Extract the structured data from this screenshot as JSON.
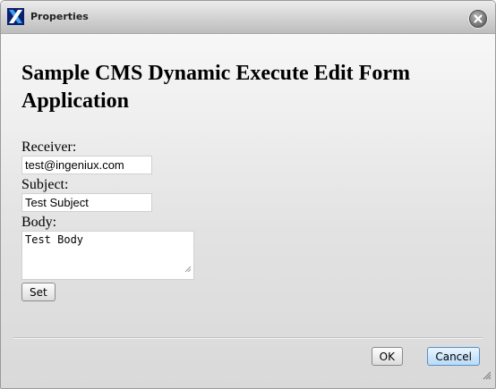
{
  "dialog": {
    "title": "Properties",
    "logo_letter": "X",
    "close_icon": "close-circle-icon",
    "resize_icon": "resize-grip-icon"
  },
  "form": {
    "heading": "Sample CMS Dynamic Execute Edit Form Application",
    "receiver_label": "Receiver:",
    "receiver_value": "test@ingeniux.com",
    "subject_label": "Subject:",
    "subject_value": "Test Subject",
    "body_label": "Body:",
    "body_value": "Test Body",
    "set_label": "Set"
  },
  "footer": {
    "ok_label": "OK",
    "cancel_label": "Cancel"
  },
  "colors": {
    "logo_dark": "#0a1f6e",
    "logo_light": "#3da0f0",
    "cancel_border": "#5a8fc4"
  }
}
